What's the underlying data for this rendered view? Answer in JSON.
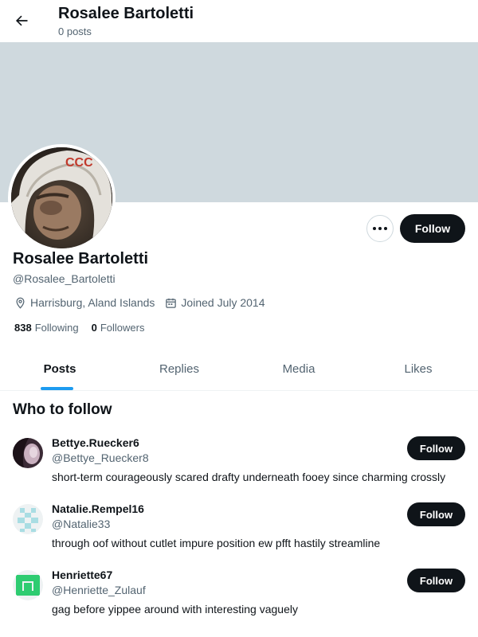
{
  "header": {
    "title": "Rosalee Bartoletti",
    "posts_count": "0 posts"
  },
  "profile": {
    "name": "Rosalee Bartoletti",
    "handle": "@Rosalee_Bartoletti",
    "location": "Harrisburg, Aland Islands",
    "joined": "Joined July 2014",
    "following_count": "838",
    "following_label": "Following",
    "followers_count": "0",
    "followers_label": "Followers",
    "follow_label": "Follow",
    "avatar_text": "CCC"
  },
  "tabs": [
    {
      "label": "Posts",
      "active": true
    },
    {
      "label": "Replies",
      "active": false
    },
    {
      "label": "Media",
      "active": false
    },
    {
      "label": "Likes",
      "active": false
    }
  ],
  "who_to_follow": {
    "title": "Who to follow",
    "users": [
      {
        "name": "Bettye.Ruecker6",
        "handle": "@Bettye_Ruecker8",
        "bio": "short-term courageously scared drafty underneath fooey since charming crossly",
        "follow_label": "Follow"
      },
      {
        "name": "Natalie.Rempel16",
        "handle": "@Natalie33",
        "bio": "through oof without cutlet impure position ew pfft hastily streamline",
        "follow_label": "Follow"
      },
      {
        "name": "Henriette67",
        "handle": "@Henriette_Zulauf",
        "bio": "gag before yippee around with interesting vaguely",
        "follow_label": "Follow"
      }
    ]
  },
  "colors": {
    "banner": "#cfd9de",
    "accent": "#1d9bf0",
    "button": "#0f1419",
    "muted_text": "#536471"
  },
  "icons": {
    "back": "arrow-left-icon",
    "more": "more-horizontal-icon",
    "location": "location-pin-icon",
    "calendar": "calendar-icon"
  }
}
